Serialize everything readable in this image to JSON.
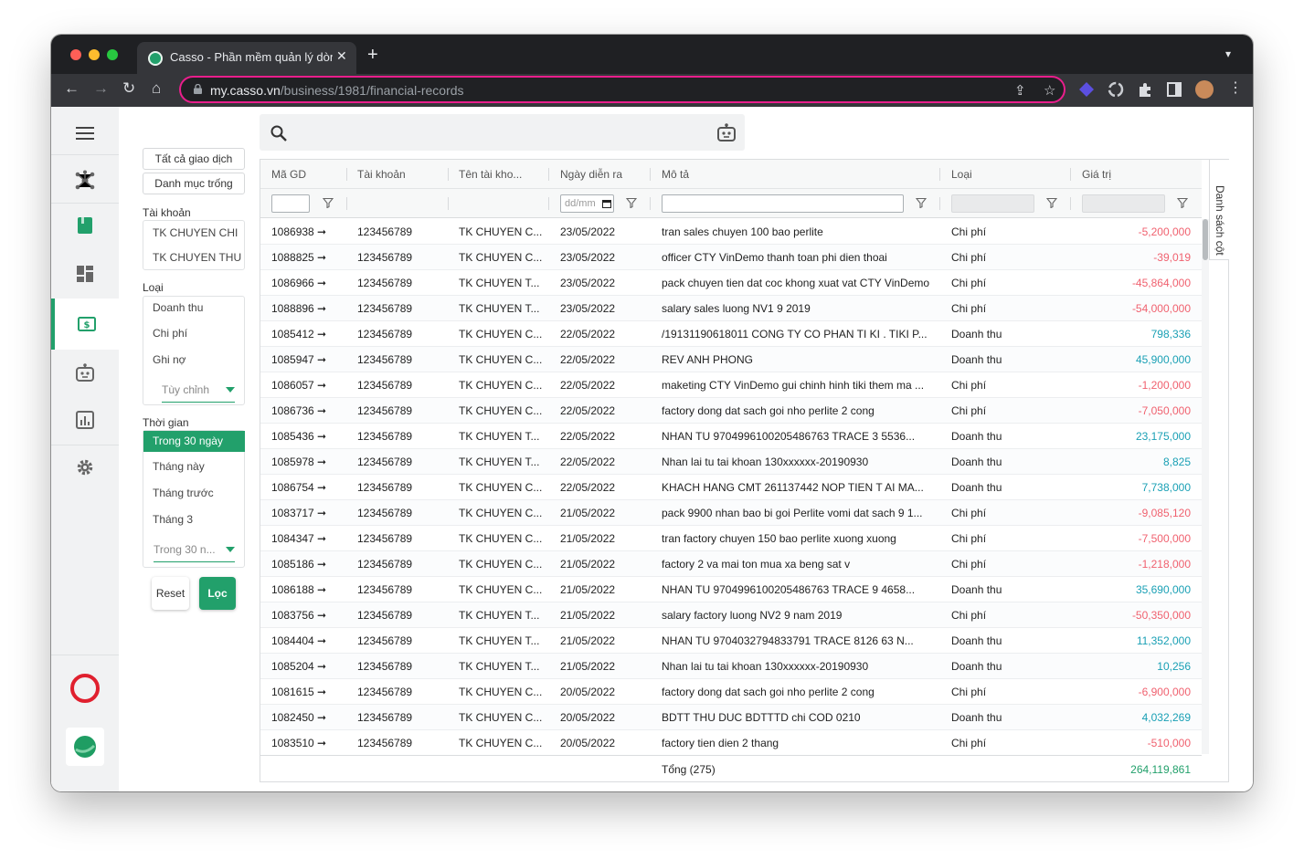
{
  "browser": {
    "tab_title": "Casso - Phần mềm quản lý dòng tiền",
    "url_host": "my.casso.vn",
    "url_path": "/business/1981/financial-records"
  },
  "colors": {
    "brand": "#22a06b",
    "negative": "#f0616f",
    "positive": "#1aa0b5"
  },
  "sidebar": {
    "items": [
      {
        "icon": "menu-icon"
      },
      {
        "icon": "network-icon"
      },
      {
        "icon": "book-icon"
      },
      {
        "icon": "dashboard-icon"
      },
      {
        "icon": "money-icon",
        "active": true
      },
      {
        "icon": "robot-icon"
      },
      {
        "icon": "chart-icon"
      },
      {
        "icon": "gear-icon"
      }
    ]
  },
  "filters": {
    "all_transactions": "Tất cả giao dịch",
    "empty_category": "Danh mục trống",
    "account_label": "Tài khoản",
    "accounts": [
      "TK CHUYEN CHI",
      "TK CHUYEN THU"
    ],
    "type_label": "Loại",
    "types": [
      "Doanh thu",
      "Chi phí",
      "Ghi nợ"
    ],
    "type_select": "Tùy chỉnh",
    "time_label": "Thời gian",
    "times": [
      "Trong 30 ngày",
      "Tháng này",
      "Tháng trước",
      "Tháng 3"
    ],
    "time_select": "Trong 30 n...",
    "reset": "Reset",
    "apply": "Lọc"
  },
  "grid": {
    "columns": [
      "Mã GD",
      "Tài khoản",
      "Tên tài kho...",
      "Ngày diễn ra",
      "Mô tả",
      "Loại",
      "Giá trị"
    ],
    "date_placeholder": "dd/mm",
    "side_panel": "Danh sách cột",
    "rows": [
      [
        "1086938 ➞",
        "123456789",
        "TK CHUYEN C...",
        "23/05/2022",
        "tran sales chuyen 100 bao perlite",
        "Chi phí",
        "-5,200,000"
      ],
      [
        "1088825 ➞",
        "123456789",
        "TK CHUYEN C...",
        "23/05/2022",
        "officer CTY VinDemo thanh toan phi dien thoai",
        "Chi phí",
        "-39,019"
      ],
      [
        "1086966 ➞",
        "123456789",
        "TK CHUYEN T...",
        "23/05/2022",
        "pack chuyen tien dat coc khong xuat vat CTY VinDemo",
        "Chi phí",
        "-45,864,000"
      ],
      [
        "1088896 ➞",
        "123456789",
        "TK CHUYEN T...",
        "23/05/2022",
        "salary sales luong NV1 9 2019",
        "Chi phí",
        "-54,000,000"
      ],
      [
        "1085412 ➞",
        "123456789",
        "TK CHUYEN C...",
        "22/05/2022",
        "/19131190618011 CONG TY CO PHAN TI KI . TIKI P...",
        "Doanh thu",
        "798,336"
      ],
      [
        "1085947 ➞",
        "123456789",
        "TK CHUYEN C...",
        "22/05/2022",
        "REV ANH PHONG",
        "Doanh thu",
        "45,900,000"
      ],
      [
        "1086057 ➞",
        "123456789",
        "TK CHUYEN C...",
        "22/05/2022",
        "maketing CTY VinDemo gui chinh hinh tiki them ma ...",
        "Chi phí",
        "-1,200,000"
      ],
      [
        "1086736 ➞",
        "123456789",
        "TK CHUYEN C...",
        "22/05/2022",
        "factory dong dat sach goi nho perlite 2 cong",
        "Chi phí",
        "-7,050,000"
      ],
      [
        "1085436 ➞",
        "123456789",
        "TK CHUYEN T...",
        "22/05/2022",
        "NHAN TU 9704996100205486763 TRACE 3 5536...",
        "Doanh thu",
        "23,175,000"
      ],
      [
        "1085978 ➞",
        "123456789",
        "TK CHUYEN T...",
        "22/05/2022",
        "Nhan lai tu tai khoan 130xxxxxx-20190930",
        "Doanh thu",
        "8,825"
      ],
      [
        "1086754 ➞",
        "123456789",
        "TK CHUYEN C...",
        "22/05/2022",
        "KHACH HANG CMT 261137442 NOP TIEN T AI MA...",
        "Doanh thu",
        "7,738,000"
      ],
      [
        "1083717 ➞",
        "123456789",
        "TK CHUYEN C...",
        "21/05/2022",
        "pack 9900 nhan bao bi goi Perlite vomi dat sach 9 1...",
        "Chi phí",
        "-9,085,120"
      ],
      [
        "1084347 ➞",
        "123456789",
        "TK CHUYEN C...",
        "21/05/2022",
        "tran factory chuyen 150 bao perlite xuong xuong",
        "Chi phí",
        "-7,500,000"
      ],
      [
        "1085186 ➞",
        "123456789",
        "TK CHUYEN C...",
        "21/05/2022",
        "factory 2 va mai ton mua xa beng sat v",
        "Chi phí",
        "-1,218,000"
      ],
      [
        "1086188 ➞",
        "123456789",
        "TK CHUYEN C...",
        "21/05/2022",
        "NHAN TU 9704996100205486763 TRACE 9 4658...",
        "Doanh thu",
        "35,690,000"
      ],
      [
        "1083756 ➞",
        "123456789",
        "TK CHUYEN T...",
        "21/05/2022",
        "salary factory luong NV2 9 nam 2019",
        "Chi phí",
        "-50,350,000"
      ],
      [
        "1084404 ➞",
        "123456789",
        "TK CHUYEN T...",
        "21/05/2022",
        "NHAN TU 9704032794833791 TRACE 8126 63 N...",
        "Doanh thu",
        "11,352,000"
      ],
      [
        "1085204 ➞",
        "123456789",
        "TK CHUYEN T...",
        "21/05/2022",
        "Nhan lai tu tai khoan 130xxxxxx-20190930",
        "Doanh thu",
        "10,256"
      ],
      [
        "1081615 ➞",
        "123456789",
        "TK CHUYEN C...",
        "20/05/2022",
        "factory dong dat sach goi nho perlite 2 cong",
        "Chi phí",
        "-6,900,000"
      ],
      [
        "1082450 ➞",
        "123456789",
        "TK CHUYEN C...",
        "20/05/2022",
        "BDTT THU DUC BDTTTD chi COD 0210",
        "Doanh thu",
        "4,032,269"
      ],
      [
        "1083510 ➞",
        "123456789",
        "TK CHUYEN C...",
        "20/05/2022",
        "factory tien dien 2 thang",
        "Chi phí",
        "-510,000"
      ]
    ],
    "total_label": "Tổng (275)",
    "total_value": "264,119,861"
  }
}
